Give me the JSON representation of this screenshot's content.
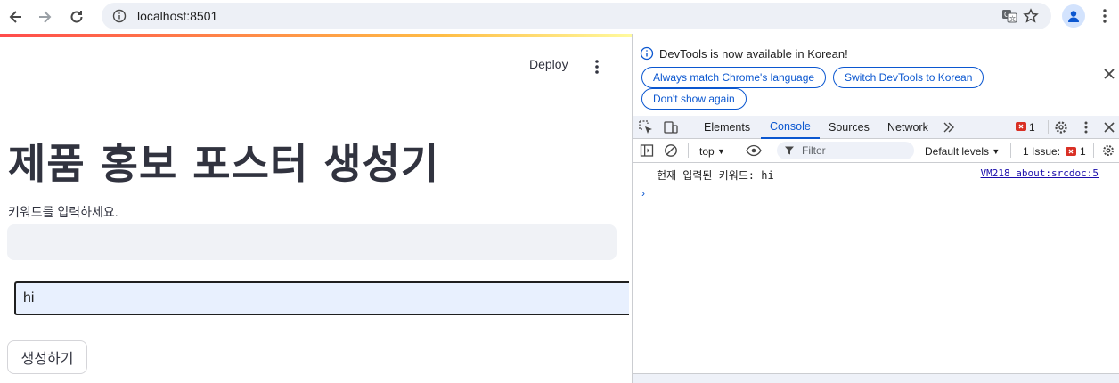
{
  "browser": {
    "url": "localhost:8501"
  },
  "app": {
    "deploy_label": "Deploy",
    "title": "제품 홍보 포스터 생성기",
    "prompt_label": "키워드를 입력하세요.",
    "text_input_value": "",
    "iframe_input_value": "hi",
    "generate_label": "생성하기"
  },
  "devtools": {
    "banner": {
      "message": "DevTools is now available in Korean!",
      "btn_match": "Always match Chrome's language",
      "btn_switch": "Switch DevTools to Korean",
      "btn_dont_show": "Don't show again"
    },
    "tabs": [
      "Elements",
      "Console",
      "Sources",
      "Network"
    ],
    "active_tab": "Console",
    "error_count": "1",
    "console_toolbar": {
      "context": "top",
      "filter_placeholder": "Filter",
      "levels": "Default levels",
      "issues_label": "1 Issue:",
      "issues_count": "1"
    },
    "log": {
      "message": "현재 입력된 키워드: hi",
      "source": "VM218 about:srcdoc:5"
    },
    "colors": {
      "accent": "#0b57d0",
      "error": "#d93025"
    }
  }
}
